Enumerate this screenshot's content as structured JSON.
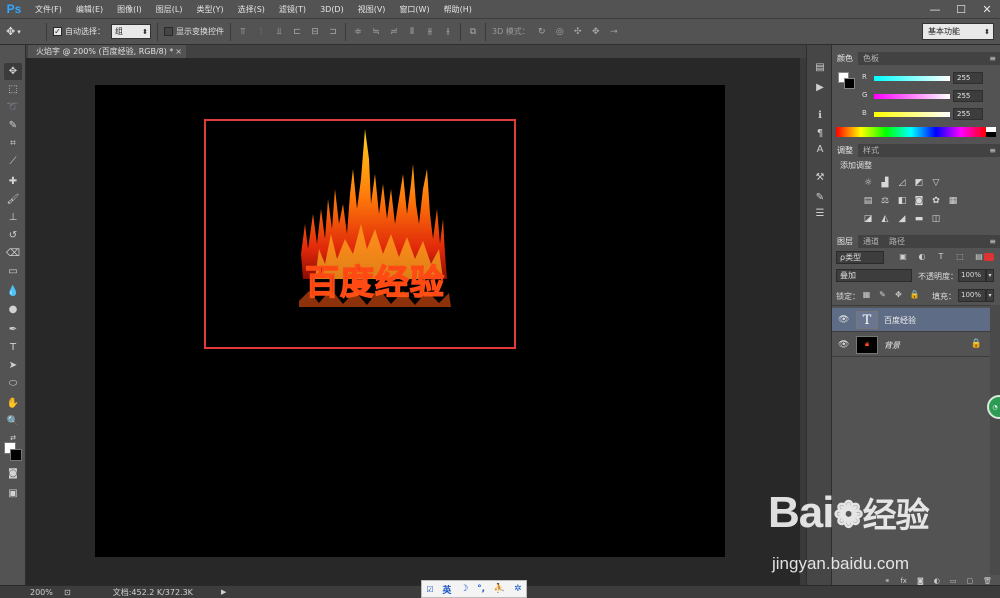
{
  "app": {
    "logo": "Ps",
    "menus": [
      "文件(F)",
      "编辑(E)",
      "图像(I)",
      "图层(L)",
      "类型(Y)",
      "选择(S)",
      "滤镜(T)",
      "3D(D)",
      "视图(V)",
      "窗口(W)",
      "帮助(H)"
    ],
    "window_controls": [
      "—",
      "☐",
      "✕"
    ]
  },
  "options": {
    "auto_select_label": "自动选择：",
    "auto_select_value": "组",
    "show_transform_label": "显示变换控件",
    "mode_3d_label": "3D 模式：",
    "workspace": "基本功能"
  },
  "document": {
    "tab_title": "火焰字 @ 200% (百度经验, RGB/8) *",
    "canvas_text": "百度经验"
  },
  "status": {
    "zoom": "200%",
    "doc_info": "文档:452.2 K/372.3K"
  },
  "ime": {
    "lang": "英"
  },
  "color_panel": {
    "tabs": [
      "颜色",
      "色板"
    ],
    "channels": [
      {
        "name": "R",
        "value": "255",
        "color": "#26d9e6"
      },
      {
        "name": "G",
        "value": "255",
        "color": "#e626d9"
      },
      {
        "name": "B",
        "value": "255",
        "color": "#e6e626"
      }
    ]
  },
  "adjust_panel": {
    "tabs": [
      "调整",
      "样式"
    ],
    "title": "添加调整"
  },
  "layers_panel": {
    "tabs": [
      "图层",
      "通道",
      "路径"
    ],
    "kind": "ρ类型",
    "blend_mode": "叠加",
    "opacity_label": "不透明度：",
    "opacity": "100%",
    "lock_label": "锁定：",
    "fill_label": "填充：",
    "fill": "100%",
    "layers": [
      {
        "name": "百度经验",
        "type": "text",
        "selected": true
      },
      {
        "name": "背景",
        "type": "image",
        "locked": true
      }
    ]
  },
  "watermark": {
    "brand": "Bai",
    "brand_cn": "经验",
    "url": "jingyan.baidu.com"
  },
  "colors": {
    "highlight": "#e03a3a",
    "selected_layer": "#5f6c86"
  }
}
